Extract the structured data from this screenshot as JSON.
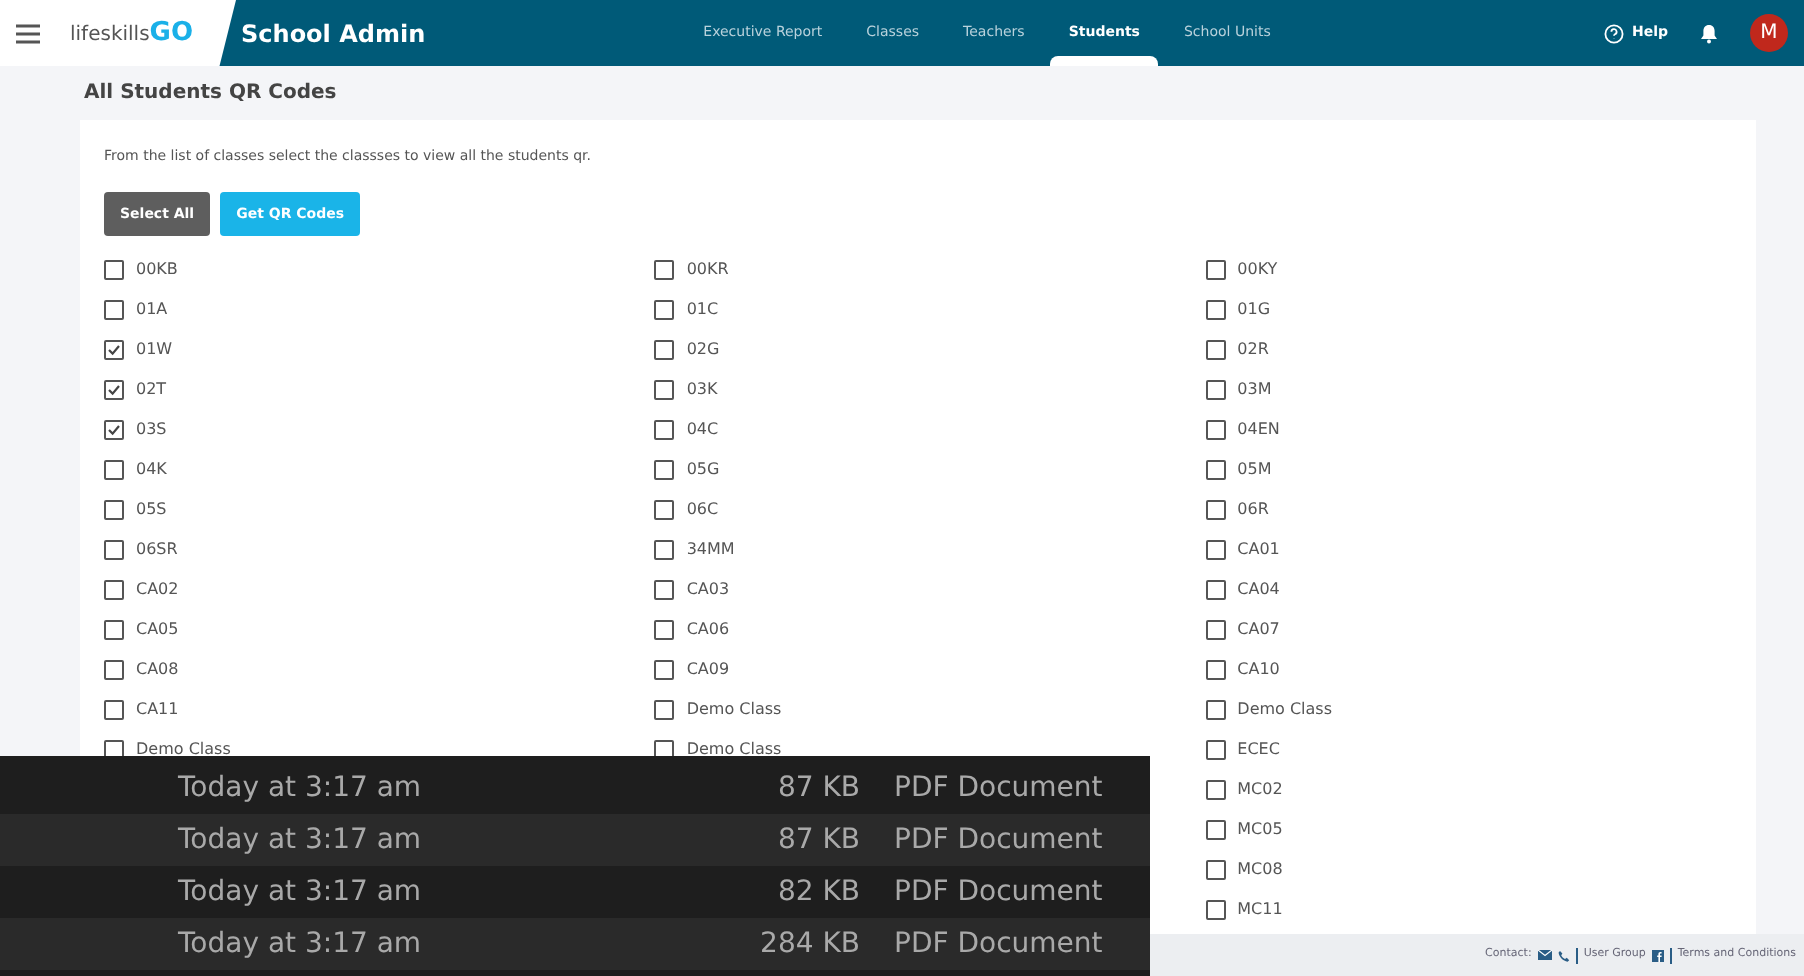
{
  "navbar": {
    "brand_light": "lifeskills",
    "brand_bold": "GO",
    "section": "School Admin",
    "tabs": [
      {
        "label": "Executive Report",
        "selected": false
      },
      {
        "label": "Classes",
        "selected": false
      },
      {
        "label": "Teachers",
        "selected": false
      },
      {
        "label": "Students",
        "selected": true
      },
      {
        "label": "School Units",
        "selected": false
      }
    ],
    "help": "Help",
    "avatar": "M"
  },
  "page_title": "All Students QR Codes",
  "instructions": "From the list of classes select the classses to view all the students qr.",
  "buttons": [
    "Select All",
    "Get QR Codes"
  ],
  "class_columns": [
    [
      {
        "label": "00KB",
        "checked": false
      },
      {
        "label": "01A",
        "checked": false
      },
      {
        "label": "01W",
        "checked": true
      },
      {
        "label": "02T",
        "checked": true
      },
      {
        "label": "03S",
        "checked": true
      },
      {
        "label": "04K",
        "checked": false
      },
      {
        "label": "05S",
        "checked": false
      },
      {
        "label": "06SR",
        "checked": false
      },
      {
        "label": "CA02",
        "checked": false
      },
      {
        "label": "CA05",
        "checked": false
      },
      {
        "label": "CA08",
        "checked": false
      },
      {
        "label": "CA11",
        "checked": false
      },
      {
        "label": "Demo Class",
        "checked": false
      }
    ],
    [
      {
        "label": "00KR",
        "checked": false
      },
      {
        "label": "01C",
        "checked": false
      },
      {
        "label": "02G",
        "checked": false
      },
      {
        "label": "03K",
        "checked": false
      },
      {
        "label": "04C",
        "checked": false
      },
      {
        "label": "05G",
        "checked": false
      },
      {
        "label": "06C",
        "checked": false
      },
      {
        "label": "34MM",
        "checked": false
      },
      {
        "label": "CA03",
        "checked": false
      },
      {
        "label": "CA06",
        "checked": false
      },
      {
        "label": "CA09",
        "checked": false
      },
      {
        "label": "Demo Class",
        "checked": false
      },
      {
        "label": "Demo Class",
        "checked": false
      }
    ],
    [
      {
        "label": "00KY",
        "checked": false
      },
      {
        "label": "01G",
        "checked": false
      },
      {
        "label": "02R",
        "checked": false
      },
      {
        "label": "03M",
        "checked": false
      },
      {
        "label": "04EN",
        "checked": false
      },
      {
        "label": "05M",
        "checked": false
      },
      {
        "label": "06R",
        "checked": false
      },
      {
        "label": "CA01",
        "checked": false
      },
      {
        "label": "CA04",
        "checked": false
      },
      {
        "label": "CA07",
        "checked": false
      },
      {
        "label": "CA10",
        "checked": false
      },
      {
        "label": "Demo Class",
        "checked": false
      },
      {
        "label": "ECEC",
        "checked": false
      },
      {
        "label": "MC02",
        "checked": false
      },
      {
        "label": "MC05",
        "checked": false
      },
      {
        "label": "MC08",
        "checked": false
      },
      {
        "label": "MC11",
        "checked": false
      }
    ]
  ],
  "footer": {
    "contact": "Contact:",
    "user_group": "User Group",
    "terms": "Terms and Conditions"
  },
  "file_list": [
    {
      "date": "Today at 3:17 am",
      "size": "87 KB",
      "kind": "PDF Document"
    },
    {
      "date": "Today at 3:17 am",
      "size": "87 KB",
      "kind": "PDF Document"
    },
    {
      "date": "Today at 3:17 am",
      "size": "82 KB",
      "kind": "PDF Document"
    },
    {
      "date": "Today at 3:17 am",
      "size": "284 KB",
      "kind": "PDF Document"
    }
  ]
}
